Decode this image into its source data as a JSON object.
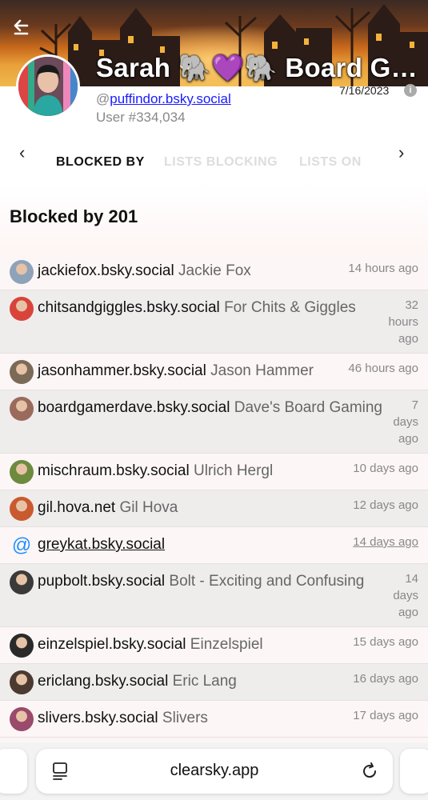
{
  "profile": {
    "display_name": "Sarah 🐘💜🐘 Board Ga…",
    "handle_prefix": "@",
    "handle": "puffindor.bsky.social",
    "user_number": "User #334,034",
    "join_date": "7/16/2023",
    "info_icon": "i"
  },
  "tabs": {
    "prev_arrow": "‹",
    "next_arrow": "›",
    "items": [
      "BLOCKED BY",
      "LISTS BLOCKING",
      "LISTS ON"
    ]
  },
  "section": {
    "title": "Blocked by 201"
  },
  "rows": [
    {
      "handle": "jackiefox.bsky.social",
      "name": "Jackie Fox",
      "time": "14 hours ago",
      "avatar_color": "#8fa3b8"
    },
    {
      "handle": "chitsandgiggles.bsky.social",
      "name": "For Chits & Giggles",
      "time": "32 hours ago",
      "avatar_color": "#d9443a"
    },
    {
      "handle": "jasonhammer.bsky.social",
      "name": "Jason Hammer",
      "time": "46 hours ago",
      "avatar_color": "#7b6a58"
    },
    {
      "handle": "boardgamerdave.bsky.social",
      "name": "Dave's Board Gaming",
      "time": "7 days ago",
      "avatar_color": "#9a6b5c"
    },
    {
      "handle": "mischraum.bsky.social",
      "name": "Ulrich Hergl",
      "time": "10 days ago",
      "avatar_color": "#6d8a3e"
    },
    {
      "handle": "gil.hova.net",
      "name": "Gil Hova",
      "time": "12 days ago",
      "avatar_color": "#c9592e"
    },
    {
      "handle": "greykat.bsky.social",
      "name": "",
      "time": "14 days ago",
      "avatar_color": "#1e8fff"
    },
    {
      "handle": "pupbolt.bsky.social",
      "name": "Bolt - Exciting and Confusing",
      "time": "14 days ago",
      "avatar_color": "#3a3a3a"
    },
    {
      "handle": "einzelspiel.bsky.social",
      "name": "Einzelspiel",
      "time": "15 days ago",
      "avatar_color": "#2a2a2a"
    },
    {
      "handle": "ericlang.bsky.social",
      "name": "Eric Lang",
      "time": "16 days ago",
      "avatar_color": "#4a3a30"
    },
    {
      "handle": "slivers.bsky.social",
      "name": "Slivers",
      "time": "17 days ago",
      "avatar_color": "#9a4a6a"
    }
  ],
  "browser": {
    "url": "clearsky.app"
  }
}
